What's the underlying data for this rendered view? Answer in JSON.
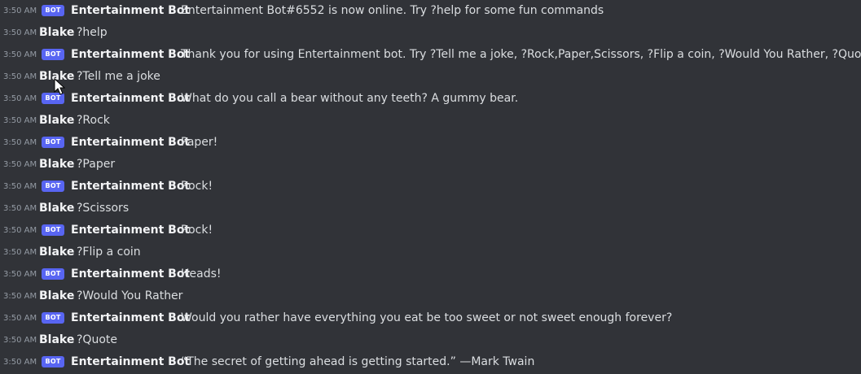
{
  "bot_badge": "BOT",
  "messages": [
    {
      "time": "3:50 AM",
      "author": "Entertainment Bot",
      "bot": true,
      "text": "Entertainment Bot#6552 is now online. Try ?help for some fun commands"
    },
    {
      "time": "3:50 AM",
      "author": "Blake",
      "bot": false,
      "text": "?help"
    },
    {
      "time": "3:50 AM",
      "author": "Entertainment Bot",
      "bot": true,
      "text": "Thank you for using Entertainment bot. Try ?Tell me a joke, ?Rock,Paper,Scissors, ?Flip a coin, ?Would You Rather, ?Quote"
    },
    {
      "time": "3:50 AM",
      "author": "Blake",
      "bot": false,
      "text": "?Tell me a joke"
    },
    {
      "time": "3:50 AM",
      "author": "Entertainment Bot",
      "bot": true,
      "text": "What do you call a bear without any teeth? A gummy bear."
    },
    {
      "time": "3:50 AM",
      "author": "Blake",
      "bot": false,
      "text": "?Rock"
    },
    {
      "time": "3:50 AM",
      "author": "Entertainment Bot",
      "bot": true,
      "text": "Paper!"
    },
    {
      "time": "3:50 AM",
      "author": "Blake",
      "bot": false,
      "text": "?Paper"
    },
    {
      "time": "3:50 AM",
      "author": "Entertainment Bot",
      "bot": true,
      "text": "Rock!"
    },
    {
      "time": "3:50 AM",
      "author": "Blake",
      "bot": false,
      "text": "?Scissors"
    },
    {
      "time": "3:50 AM",
      "author": "Entertainment Bot",
      "bot": true,
      "text": "Rock!"
    },
    {
      "time": "3:50 AM",
      "author": "Blake",
      "bot": false,
      "text": "?Flip a coin"
    },
    {
      "time": "3:50 AM",
      "author": "Entertainment Bot",
      "bot": true,
      "text": "Heads!"
    },
    {
      "time": "3:50 AM",
      "author": "Blake",
      "bot": false,
      "text": "?Would You Rather"
    },
    {
      "time": "3:50 AM",
      "author": "Entertainment Bot",
      "bot": true,
      "text": "Would you rather have everything you eat be too sweet or not sweet enough forever?"
    },
    {
      "time": "3:50 AM",
      "author": "Blake",
      "bot": false,
      "text": "?Quote"
    },
    {
      "time": "3:50 AM",
      "author": "Entertainment Bot",
      "bot": true,
      "text": "“The secret of getting ahead is getting started.” —Mark Twain"
    }
  ],
  "colors": {
    "background": "#313338",
    "bot_badge": "#5865f2",
    "author": "#f2f3f5",
    "message_text": "#dbdee1",
    "timestamp": "#949ba4"
  },
  "icons": {
    "cursor": "mouse-pointer-icon"
  }
}
